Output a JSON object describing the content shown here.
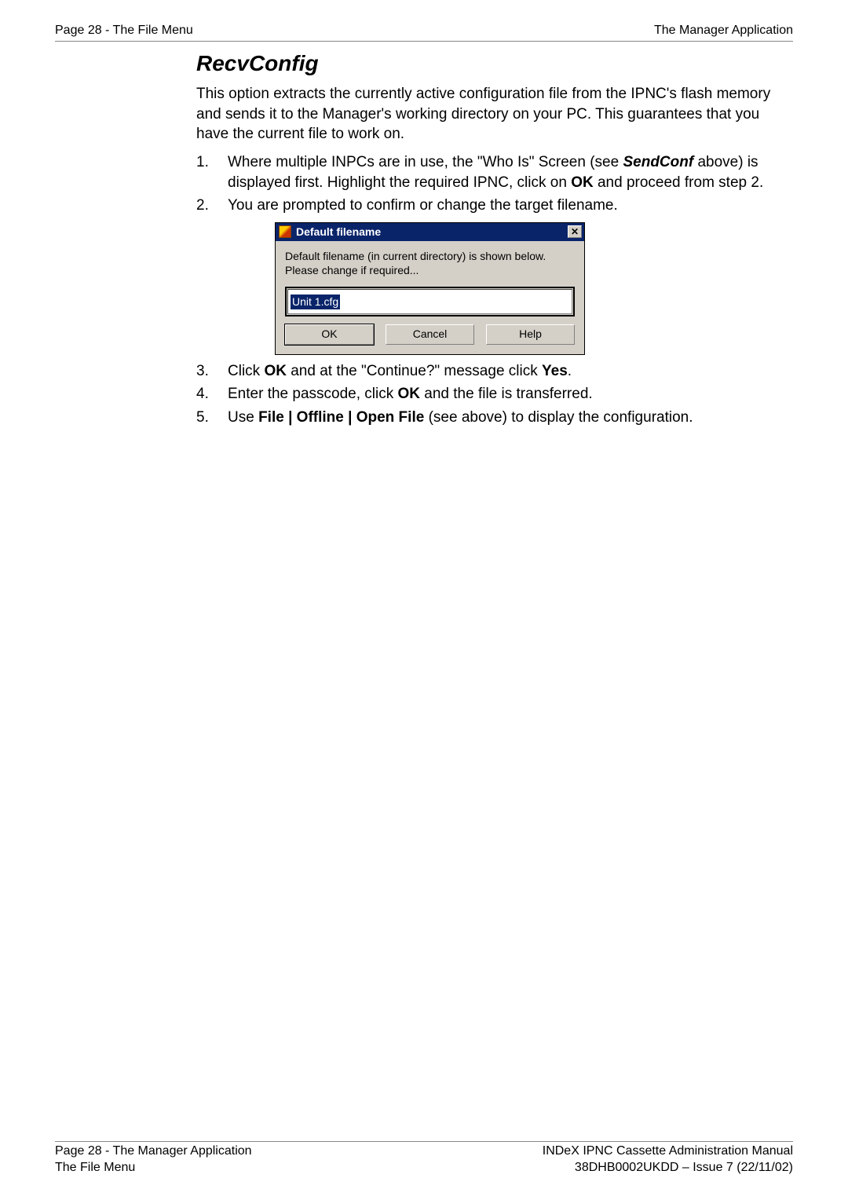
{
  "header": {
    "left": "Page 28 - The File Menu",
    "right": "The Manager Application"
  },
  "section": {
    "title": "RecvConfig",
    "intro": "This option extracts the currently active configuration file from the IPNC's flash memory and sends it to the Manager's working directory on your PC. This guarantees that you have the current file to work on."
  },
  "steps": {
    "s1_a": "Where multiple INPCs are in use, the \"Who Is\" Screen (see ",
    "s1_sendconf": "SendConf",
    "s1_b": " above) is displayed first. Highlight the required IPNC, click on ",
    "s1_ok": "OK",
    "s1_c": " and proceed from step 2.",
    "s2": "You are prompted to confirm or change the target filename.",
    "s3_a": "Click ",
    "s3_ok": "OK",
    "s3_b": " and at the \"Continue?\" message click ",
    "s3_yes": "Yes",
    "s3_c": ".",
    "s4_a": "Enter the passcode, click ",
    "s4_ok": "OK",
    "s4_b": " and the file is transferred.",
    "s5_a": "Use ",
    "s5_menu": "File | Offline | Open File",
    "s5_b": " (see above) to display the configuration."
  },
  "dialog": {
    "title": "Default filename",
    "close_glyph": "✕",
    "message": "Default filename (in current directory) is shown below.  Please change if required...",
    "filename": "Unit 1.cfg",
    "ok": "OK",
    "cancel": "Cancel",
    "help": "Help"
  },
  "footer": {
    "left1": "Page 28 - The Manager Application",
    "left2": "The File Menu",
    "right1": "INDeX IPNC Cassette Administration Manual",
    "right2": "38DHB0002UKDD – Issue 7 (22/11/02)"
  }
}
